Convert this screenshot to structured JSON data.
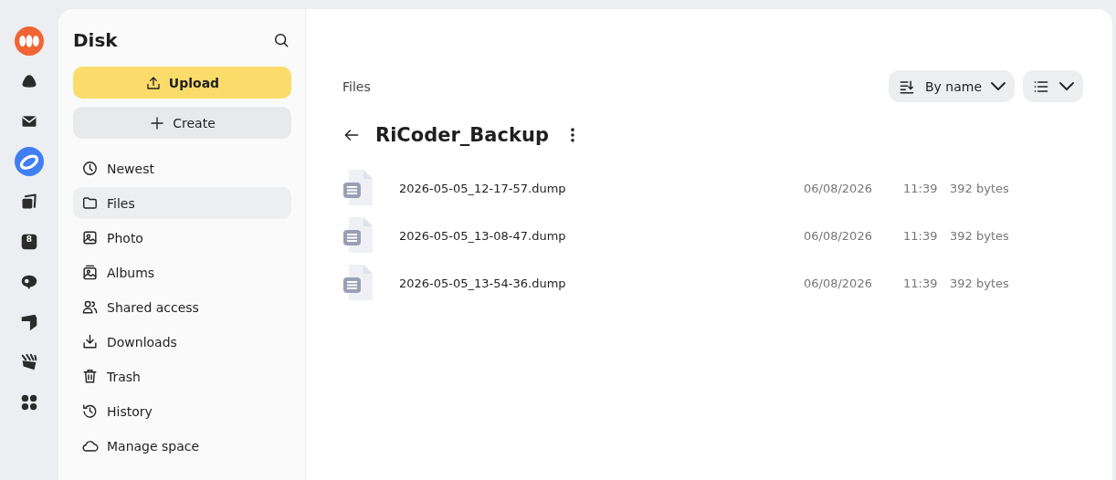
{
  "rail": [
    {
      "kind": "logo"
    },
    {
      "kind": "drop",
      "selected": false
    },
    {
      "kind": "mail",
      "selected": false
    },
    {
      "kind": "disk",
      "selected": true
    },
    {
      "kind": "cards",
      "selected": false
    },
    {
      "kind": "calendar",
      "selected": false,
      "badge": "8"
    },
    {
      "kind": "chat",
      "selected": false
    },
    {
      "kind": "shield",
      "selected": false
    },
    {
      "kind": "clapper",
      "selected": false
    },
    {
      "kind": "apps",
      "selected": false
    }
  ],
  "sidebar": {
    "title": "Disk",
    "upload": "Upload",
    "create": "Create",
    "items": [
      {
        "kind": "clock",
        "label": "Newest",
        "selected": false
      },
      {
        "kind": "folder",
        "label": "Files",
        "selected": true
      },
      {
        "kind": "photo",
        "label": "Photo",
        "selected": false
      },
      {
        "kind": "album",
        "label": "Albums",
        "selected": false
      },
      {
        "kind": "people",
        "label": "Shared access",
        "selected": false
      },
      {
        "kind": "download",
        "label": "Downloads",
        "selected": false
      },
      {
        "kind": "trash",
        "label": "Trash",
        "selected": false
      },
      {
        "kind": "history",
        "label": "History",
        "selected": false
      },
      {
        "kind": "cloud",
        "label": "Manage space",
        "selected": false
      }
    ]
  },
  "breadcrumb": "Files",
  "sort": "By name",
  "folder_title": "RiCoder_Backup",
  "files": [
    {
      "name": "2026-05-05_12-17-57.dump",
      "date": "06/08/2026",
      "time": "11:39",
      "size": "392 bytes"
    },
    {
      "name": "2026-05-05_13-08-47.dump",
      "date": "06/08/2026",
      "time": "11:39",
      "size": "392 bytes"
    },
    {
      "name": "2026-05-05_13-54-36.dump",
      "date": "06/08/2026",
      "time": "11:39",
      "size": "392 bytes"
    }
  ]
}
